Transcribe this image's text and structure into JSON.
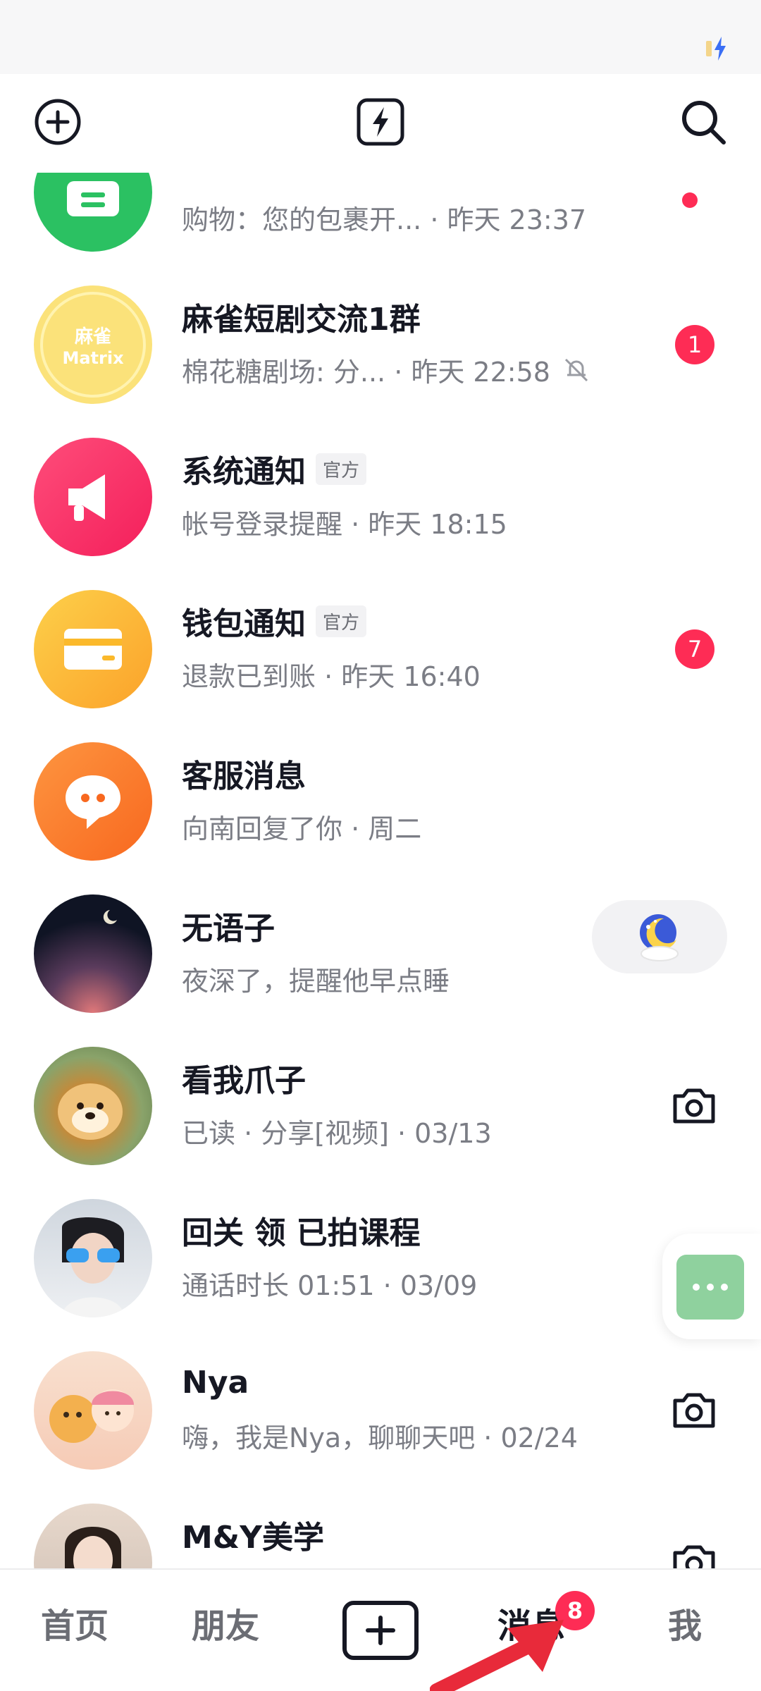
{
  "header": {
    "add_icon": "plus-circle-icon",
    "flash_icon": "lightning-icon",
    "search_icon": "search-icon"
  },
  "conversations": [
    {
      "name": "",
      "preview": "购物：您的包裹开... · 昨天 23:37",
      "avatar_color": "#2bc162",
      "avatar_icon": "package-icon",
      "indicator": "dot"
    },
    {
      "name": "麻雀短剧交流1群",
      "preview": "棉花糖剧场: 分... · 昨天 22:58",
      "avatar_color": "#fbe27a",
      "avatar_text": [
        "麻雀",
        "Matrix"
      ],
      "badge": "1",
      "muted": true
    },
    {
      "name": "系统通知",
      "tag": "官方",
      "preview": "帐号登录提醒 · 昨天 18:15",
      "avatar_color": "#fb3b6b",
      "avatar_icon": "megaphone-icon"
    },
    {
      "name": "钱包通知",
      "tag": "官方",
      "preview": "退款已到账 · 昨天 16:40",
      "avatar_color": "#fbb92b",
      "avatar_icon": "card-icon",
      "badge": "7"
    },
    {
      "name": "客服消息",
      "preview": "向南回复了你 · 周二",
      "avatar_color": "#fb7b27",
      "avatar_icon": "chat-bubble-icon"
    },
    {
      "name": "无语子",
      "preview": "夜深了，提醒他早点睡",
      "avatar_color": "#0f1424",
      "avatar_icon": "night-sky",
      "action": "sleep-sticker"
    },
    {
      "name": "看我爪子",
      "preview": "已读 · 分享[视频] · 03/13",
      "avatar_color": "#8aa36a",
      "avatar_icon": "dog-photo",
      "action": "camera"
    },
    {
      "name": "回关 领 已拍课程",
      "preview": "通话时长 01:51 · 03/09",
      "avatar_color": "#d9dde3",
      "avatar_icon": "person-photo"
    },
    {
      "name": "Nya",
      "preview": "嗨，我是Nya，聊聊天吧 · 02/24",
      "avatar_color": "#f6cbb6",
      "avatar_icon": "cartoon-photo",
      "action": "camera"
    },
    {
      "name": "M&Y美学",
      "preview": "",
      "avatar_color": "#e7d8cc",
      "avatar_icon": "person-photo",
      "action": "camera"
    }
  ],
  "nav": {
    "home": "首页",
    "friends": "朋友",
    "messages": "消息",
    "me": "我",
    "messages_badge": "8"
  },
  "colors": {
    "accent": "#fe2c55",
    "text": "#161823",
    "muted": "#7b7d85"
  }
}
